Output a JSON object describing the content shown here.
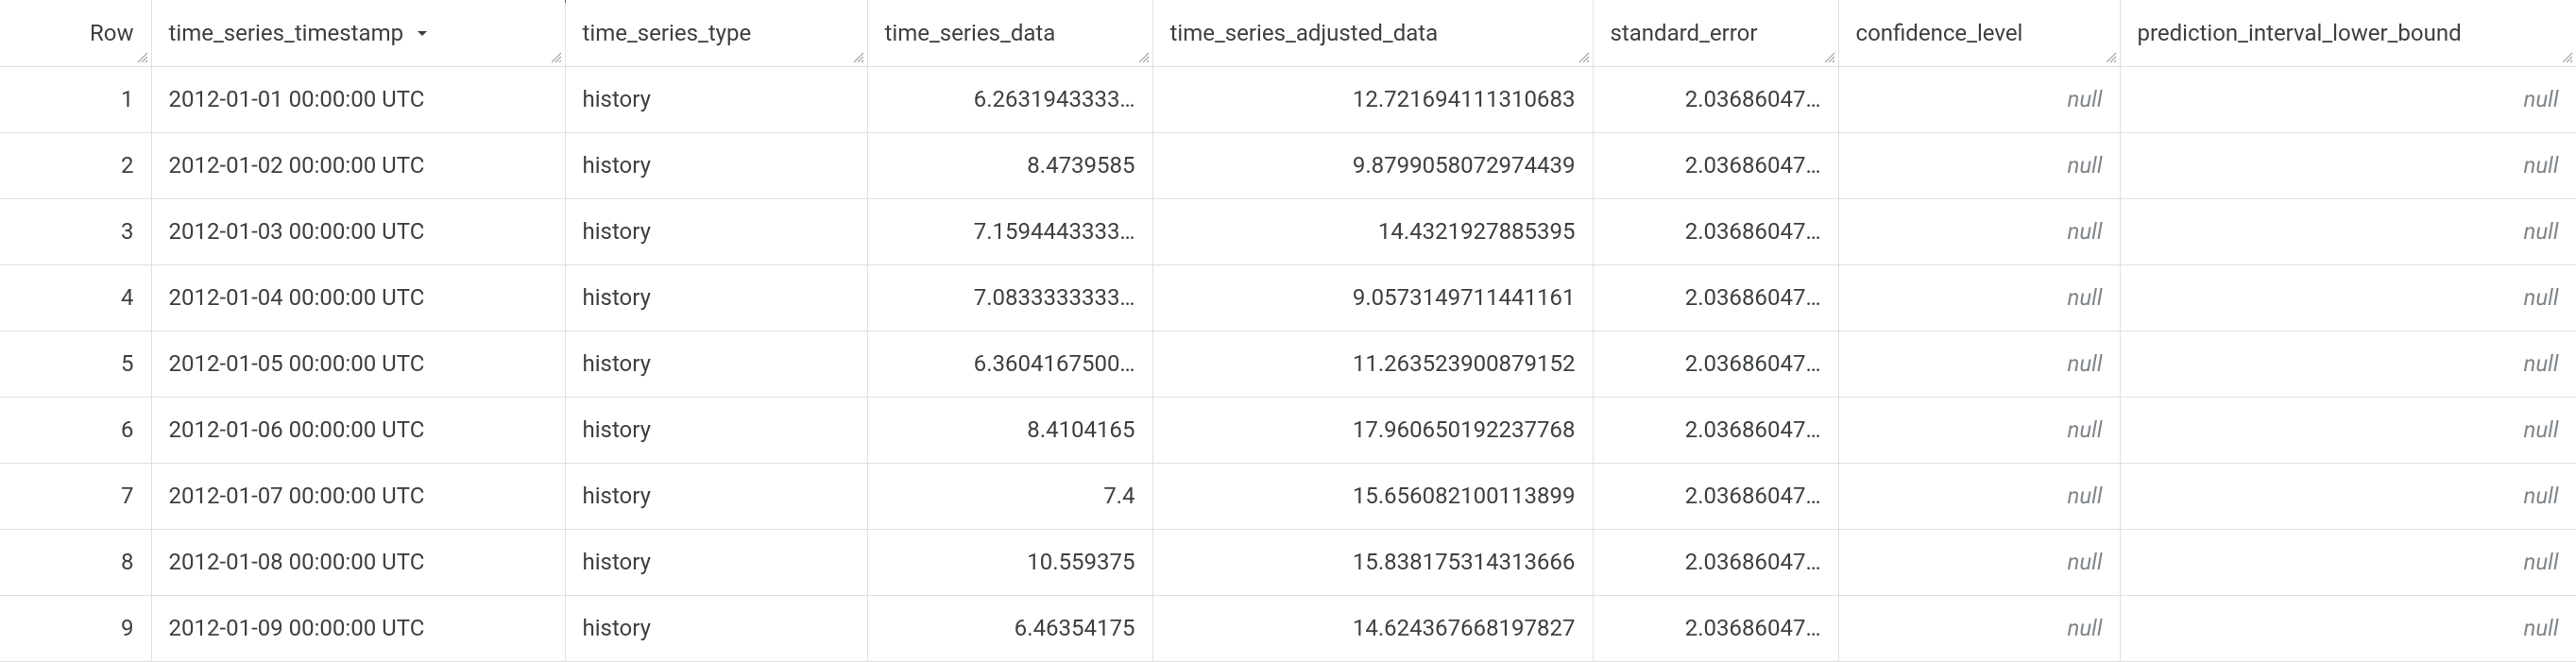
{
  "columns": {
    "row": "Row",
    "time_series_timestamp": "time_series_timestamp",
    "time_series_type": "time_series_type",
    "time_series_data": "time_series_data",
    "time_series_adjusted_data": "time_series_adjusted_data",
    "standard_error": "standard_error",
    "confidence_level": "confidence_level",
    "prediction_interval_lower_bound": "prediction_interval_lower_bound"
  },
  "sort": {
    "column": "time_series_timestamp",
    "direction": "asc"
  },
  "null_label": "null",
  "rows": [
    {
      "row": "1",
      "time_series_timestamp": "2012-01-01 00:00:00 UTC",
      "time_series_type": "history",
      "time_series_data": "6.2631943333…",
      "time_series_adjusted_data": "12.721694111310683",
      "standard_error": "2.03686047…",
      "confidence_level": null,
      "prediction_interval_lower_bound": null
    },
    {
      "row": "2",
      "time_series_timestamp": "2012-01-02 00:00:00 UTC",
      "time_series_type": "history",
      "time_series_data": "8.4739585",
      "time_series_adjusted_data": "9.8799058072974439",
      "standard_error": "2.03686047…",
      "confidence_level": null,
      "prediction_interval_lower_bound": null
    },
    {
      "row": "3",
      "time_series_timestamp": "2012-01-03 00:00:00 UTC",
      "time_series_type": "history",
      "time_series_data": "7.1594443333…",
      "time_series_adjusted_data": "14.4321927885395",
      "standard_error": "2.03686047…",
      "confidence_level": null,
      "prediction_interval_lower_bound": null
    },
    {
      "row": "4",
      "time_series_timestamp": "2012-01-04 00:00:00 UTC",
      "time_series_type": "history",
      "time_series_data": "7.0833333333…",
      "time_series_adjusted_data": "9.0573149711441161",
      "standard_error": "2.03686047…",
      "confidence_level": null,
      "prediction_interval_lower_bound": null
    },
    {
      "row": "5",
      "time_series_timestamp": "2012-01-05 00:00:00 UTC",
      "time_series_type": "history",
      "time_series_data": "6.3604167500…",
      "time_series_adjusted_data": "11.263523900879152",
      "standard_error": "2.03686047…",
      "confidence_level": null,
      "prediction_interval_lower_bound": null
    },
    {
      "row": "6",
      "time_series_timestamp": "2012-01-06 00:00:00 UTC",
      "time_series_type": "history",
      "time_series_data": "8.4104165",
      "time_series_adjusted_data": "17.960650192237768",
      "standard_error": "2.03686047…",
      "confidence_level": null,
      "prediction_interval_lower_bound": null
    },
    {
      "row": "7",
      "time_series_timestamp": "2012-01-07 00:00:00 UTC",
      "time_series_type": "history",
      "time_series_data": "7.4",
      "time_series_adjusted_data": "15.656082100113899",
      "standard_error": "2.03686047…",
      "confidence_level": null,
      "prediction_interval_lower_bound": null
    },
    {
      "row": "8",
      "time_series_timestamp": "2012-01-08 00:00:00 UTC",
      "time_series_type": "history",
      "time_series_data": "10.559375",
      "time_series_adjusted_data": "15.838175314313666",
      "standard_error": "2.03686047…",
      "confidence_level": null,
      "prediction_interval_lower_bound": null
    },
    {
      "row": "9",
      "time_series_timestamp": "2012-01-09 00:00:00 UTC",
      "time_series_type": "history",
      "time_series_data": "6.46354175",
      "time_series_adjusted_data": "14.624367668197827",
      "standard_error": "2.03686047…",
      "confidence_level": null,
      "prediction_interval_lower_bound": null
    }
  ]
}
